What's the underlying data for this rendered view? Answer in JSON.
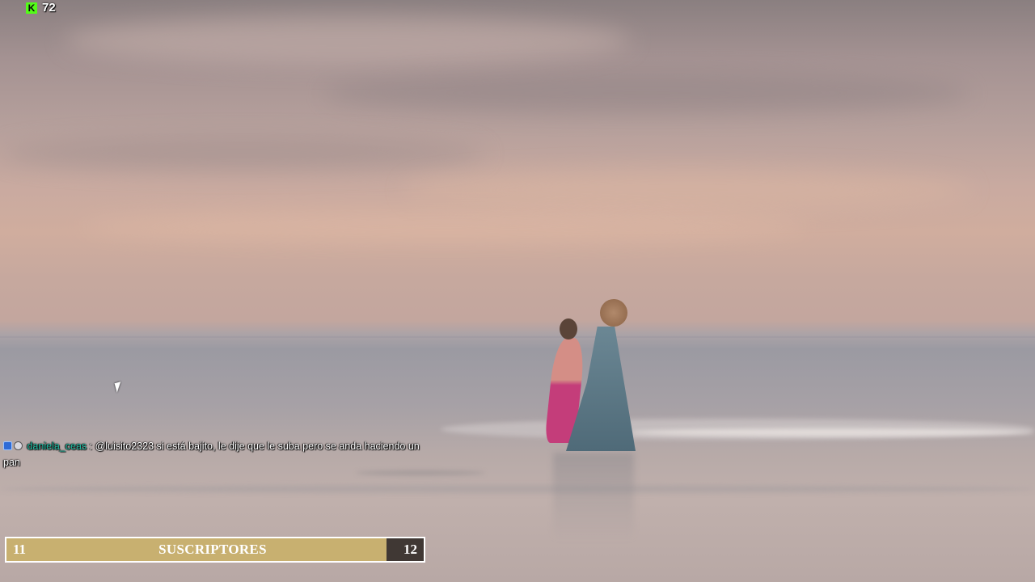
{
  "stream_overlay": {
    "viewer_count": "72",
    "platform_icon": "kick-logo-icon",
    "platform_icon_letter": "K"
  },
  "chat": {
    "message": {
      "badges": [
        "verified-badge-icon",
        "subscriber-badge-icon"
      ],
      "username": "daniela_ceas",
      "separator": " : ",
      "text": "@luisito2323 si está bajito, le dije que le suba pero se anda haciendo un pan"
    }
  },
  "sub_goal": {
    "current": "11",
    "label": "SUSCRIPTORES",
    "target": "12",
    "progress": 0.91
  },
  "colors": {
    "platform_green": "#53fc18",
    "username_color": "#1fc0a6",
    "goal_fill": "#c8b070",
    "goal_background": "#403834"
  }
}
